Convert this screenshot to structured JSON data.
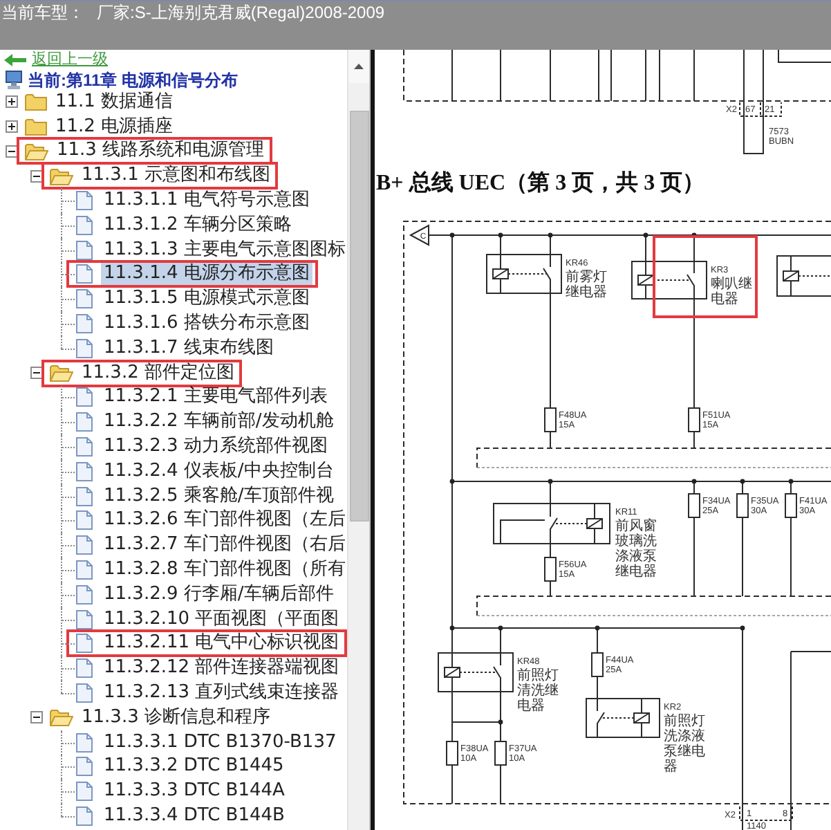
{
  "header": {
    "label": "当前车型：",
    "vehicle": "厂家:S-上海别克君威(Regal)2008-2009"
  },
  "tree_panel": {
    "back_link": "返回上一级",
    "current_chapter": "当前:第11章 电源和信号分布",
    "items": [
      {
        "kind": "folder",
        "label": "11.1 数据通信",
        "expanded": false,
        "selected": false,
        "highlighted": false
      },
      {
        "kind": "folder",
        "label": "11.2 电源插座",
        "expanded": false,
        "selected": false,
        "highlighted": false
      },
      {
        "kind": "folder",
        "label": "11.3 线路系统和电源管理",
        "expanded": true,
        "selected": false,
        "highlighted": true,
        "children": [
          {
            "kind": "folder",
            "label": "11.3.1 示意图和布线图",
            "expanded": true,
            "selected": false,
            "highlighted": true,
            "children": [
              {
                "kind": "page",
                "label": "11.3.1.1 电气符号示意图",
                "selected": false,
                "highlighted": false
              },
              {
                "kind": "page",
                "label": "11.3.1.2 车辆分区策略",
                "selected": false,
                "highlighted": false
              },
              {
                "kind": "page",
                "label": "11.3.1.3 主要电气示意图图标",
                "selected": false,
                "highlighted": false
              },
              {
                "kind": "page",
                "label": "11.3.1.4 电源分布示意图",
                "selected": true,
                "highlighted": true
              },
              {
                "kind": "page",
                "label": "11.3.1.5 电源模式示意图",
                "selected": false,
                "highlighted": false
              },
              {
                "kind": "page",
                "label": "11.3.1.6 搭铁分布示意图",
                "selected": false,
                "highlighted": false
              },
              {
                "kind": "page",
                "label": "11.3.1.7 线束布线图",
                "selected": false,
                "highlighted": false
              }
            ]
          },
          {
            "kind": "folder",
            "label": "11.3.2 部件定位图",
            "expanded": true,
            "selected": false,
            "highlighted": true,
            "children": [
              {
                "kind": "page",
                "label": "11.3.2.1 主要电气部件列表",
                "selected": false,
                "highlighted": false
              },
              {
                "kind": "page",
                "label": "11.3.2.2 车辆前部/发动机舱",
                "selected": false,
                "highlighted": false
              },
              {
                "kind": "page",
                "label": "11.3.2.3 动力系统部件视图",
                "selected": false,
                "highlighted": false
              },
              {
                "kind": "page",
                "label": "11.3.2.4 仪表板/中央控制台",
                "selected": false,
                "highlighted": false
              },
              {
                "kind": "page",
                "label": "11.3.2.5 乘客舱/车顶部件视",
                "selected": false,
                "highlighted": false
              },
              {
                "kind": "page",
                "label": "11.3.2.6 车门部件视图（左后",
                "selected": false,
                "highlighted": false
              },
              {
                "kind": "page",
                "label": "11.3.2.7 车门部件视图（右后",
                "selected": false,
                "highlighted": false
              },
              {
                "kind": "page",
                "label": "11.3.2.8 车门部件视图（所有",
                "selected": false,
                "highlighted": false
              },
              {
                "kind": "page",
                "label": "11.3.2.9 行李厢/车辆后部件",
                "selected": false,
                "highlighted": false
              },
              {
                "kind": "page",
                "label": "11.3.2.10 平面视图（平面图",
                "selected": false,
                "highlighted": false
              },
              {
                "kind": "page",
                "label": "11.3.2.11 电气中心标识视图",
                "selected": false,
                "highlighted": true
              },
              {
                "kind": "page",
                "label": "11.3.2.12 部件连接器端视图",
                "selected": false,
                "highlighted": false
              },
              {
                "kind": "page",
                "label": "11.3.2.13 直列式线束连接器",
                "selected": false,
                "highlighted": false
              }
            ]
          },
          {
            "kind": "folder",
            "label": "11.3.3 诊断信息和程序",
            "expanded": true,
            "selected": false,
            "highlighted": false,
            "children": [
              {
                "kind": "page",
                "label": "11.3.3.1 DTC B1370-B137",
                "selected": false,
                "highlighted": false
              },
              {
                "kind": "page",
                "label": "11.3.3.2 DTC B1445",
                "selected": false,
                "highlighted": false
              },
              {
                "kind": "page",
                "label": "11.3.3.3 DTC B144A",
                "selected": false,
                "highlighted": false
              },
              {
                "kind": "page",
                "label": "11.3.3.4 DTC B144B",
                "selected": false,
                "highlighted": false
              }
            ]
          }
        ]
      }
    ]
  },
  "diagram": {
    "upper_connector": {
      "name": "X2",
      "pins": [
        "67",
        "21"
      ],
      "circuit": "7573",
      "wire_color": "BUBN"
    },
    "heading": "B+ 总线 UEC（第 3 页，共 3 页）",
    "bus_connector": "C",
    "relays": [
      {
        "id_label": "KR46",
        "name": "前雾灯继电器",
        "highlighted": false
      },
      {
        "id_label": "KR3",
        "name": "喇叭继电器",
        "highlighted": true
      },
      {
        "highlighted": false
      },
      {
        "id_label": "KR11",
        "name": "前风窗玻璃洗涤液泵继电器",
        "highlighted": false
      },
      {
        "id_label": "KR48",
        "name": "前照灯清洗继电器",
        "highlighted": false
      },
      {
        "id_label": "KR2",
        "name": "前照灯洗涤液泵继电器",
        "highlighted": false
      }
    ],
    "fuses": [
      {
        "id_label": "F48UA",
        "rating": "15A"
      },
      {
        "id_label": "F51UA",
        "rating": "15A"
      },
      {
        "id_label": "F34UA",
        "rating": "25A"
      },
      {
        "id_label": "F35UA",
        "rating": "30A"
      },
      {
        "id_label": "F41UA",
        "rating": "30A"
      },
      {
        "id_label": "F56UA",
        "rating": "15A"
      },
      {
        "id_label": "F44UA",
        "rating": "25A"
      },
      {
        "id_label": "F38UA",
        "rating": "10A"
      },
      {
        "id_label": "F37UA",
        "rating": "10A"
      }
    ],
    "lower_connector": {
      "name": "X2",
      "pins": [
        "1",
        "8"
      ],
      "circuit": "1140"
    }
  }
}
